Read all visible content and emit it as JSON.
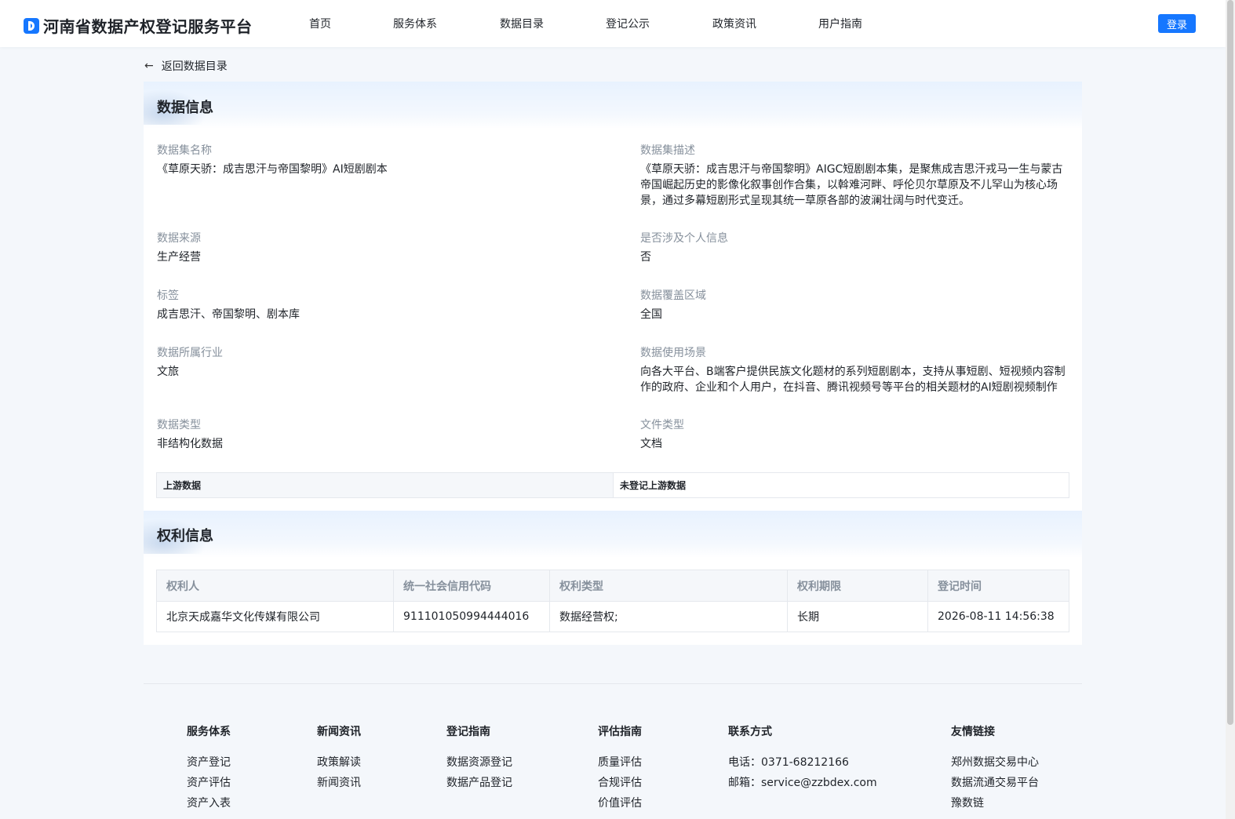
{
  "header": {
    "logo_text": "河南省数据产权登记服务平台",
    "nav": [
      "首页",
      "服务体系",
      "数据目录",
      "登记公示",
      "政策资讯",
      "用户指南"
    ],
    "login_label": "登录"
  },
  "back_label": "返回数据目录",
  "data_info": {
    "title": "数据信息",
    "fields": [
      {
        "label": "数据集名称",
        "value": "《草原天骄：成吉思汗与帝国黎明》AI短剧剧本"
      },
      {
        "label": "数据集描述",
        "value": "《草原天骄：成吉思汗与帝国黎明》AIGC短剧剧本集，是聚焦成吉思汗戎马一生与蒙古帝国崛起历史的影像化叙事创作合集，以斡难河畔、呼伦贝尔草原及不儿罕山为核心场景，通过多幕短剧形式呈现其统一草原各部的波澜壮阔与时代变迁。"
      },
      {
        "label": "数据来源",
        "value": "生产经营"
      },
      {
        "label": "是否涉及个人信息",
        "value": "否"
      },
      {
        "label": "标签",
        "value": "成吉思汗、帝国黎明、剧本库"
      },
      {
        "label": "数据覆盖区域",
        "value": "全国"
      },
      {
        "label": "数据所属行业",
        "value": "文旅"
      },
      {
        "label": "数据使用场景",
        "value": "向各大平台、B端客户提供民族文化题材的系列短剧剧本，支持从事短剧、短视频内容制作的政府、企业和个人用户，在抖音、腾讯视频号等平台的相关题材的AI短剧视频制作"
      },
      {
        "label": "数据类型",
        "value": "非结构化数据"
      },
      {
        "label": "文件类型",
        "value": "文档"
      }
    ],
    "upstream_label": "上游数据",
    "upstream_value": "未登记上游数据"
  },
  "rights_info": {
    "title": "权利信息",
    "columns": [
      "权利人",
      "统一社会信用代码",
      "权利类型",
      "权利期限",
      "登记时间"
    ],
    "rows": [
      [
        "北京天成嘉华文化传媒有限公司",
        "911101050994444016",
        "数据经营权;",
        "长期",
        "2026-08-11 14:56:38"
      ]
    ]
  },
  "footer": {
    "columns": [
      {
        "title": "服务体系",
        "links": [
          "资产登记",
          "资产评估",
          "资产入表"
        ]
      },
      {
        "title": "新闻资讯",
        "links": [
          "政策解读",
          "新闻资讯"
        ]
      },
      {
        "title": "登记指南",
        "links": [
          "数据资源登记",
          "数据产品登记"
        ]
      },
      {
        "title": "评估指南",
        "links": [
          "质量评估",
          "合规评估",
          "价值评估"
        ]
      },
      {
        "title": "联系方式",
        "links": [
          "电话：0371-68212166",
          "邮箱：service@zzbdex.com"
        ]
      },
      {
        "title": "友情链接",
        "links": [
          "郑州数据交易中心",
          "数据流通交易平台",
          "豫数链"
        ]
      }
    ]
  },
  "colors": {
    "accent": "#1677ff",
    "label_gray": "#86909c",
    "background": "#f4f7fb"
  }
}
